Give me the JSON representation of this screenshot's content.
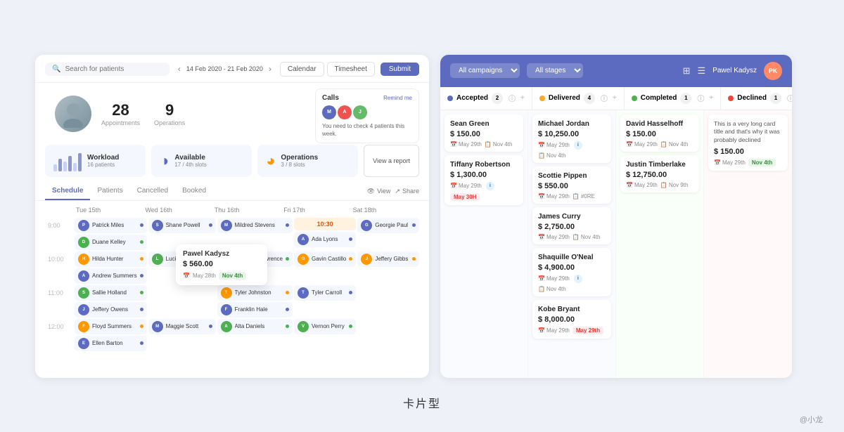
{
  "page": {
    "background": "#eef1f7",
    "bottom_label": "卡片型",
    "watermark": "@小龙"
  },
  "left_panel": {
    "search_placeholder": "Search for patients",
    "date_range": "14 Feb 2020 - 21 Feb 2020",
    "tabs": [
      "Calendar",
      "Timesheet"
    ],
    "submit_label": "Submit",
    "doctor": {
      "appointments": "28",
      "appointments_label": "Appointments",
      "operations": "9",
      "operations_label": "Operations"
    },
    "calls": {
      "title": "Calls",
      "remind_label": "Remind me",
      "text": "You need to check 4 patients this week."
    },
    "metrics": {
      "workload": {
        "title": "Workload",
        "sub": "16 patients"
      },
      "available": {
        "title": "Available",
        "sub": "17 / 4th slots"
      },
      "operations": {
        "title": "Operations",
        "sub": "3 / 8 slots"
      },
      "view_report": "View a report"
    },
    "schedule_tabs": [
      "Schedule",
      "Patients",
      "Cancelled",
      "Booked"
    ],
    "view_label": "View",
    "share_label": "Share",
    "days": [
      "Tue 15th",
      "Wed 16th",
      "Thu 16th",
      "Fri 17th",
      "Sat 18th"
    ],
    "times": [
      "9:00",
      "10:00",
      "11:00",
      "12:00"
    ],
    "appointments": {
      "tue": [
        {
          "name": "Patrick Miles",
          "color": "blue"
        },
        {
          "name": "Duane Kelley",
          "color": "green"
        },
        {
          "name": "Hilda Hunter",
          "color": "orange"
        },
        {
          "name": "Andrew Summers",
          "color": "blue"
        },
        {
          "name": "Sallie Holland",
          "color": "green"
        },
        {
          "name": "Jeffery Owens",
          "color": "blue"
        },
        {
          "name": "Floyd Summers",
          "color": "orange"
        },
        {
          "name": "Ellen Barton",
          "color": "blue"
        }
      ],
      "wed": [
        {
          "name": "Shane Powell",
          "color": "blue"
        },
        {
          "name": "",
          "color": ""
        },
        {
          "name": "",
          "color": ""
        },
        {
          "name": "Lucinda Stanley",
          "color": "green"
        },
        {
          "name": "",
          "color": ""
        },
        {
          "name": "",
          "color": ""
        },
        {
          "name": "Maggie Scott",
          "color": "blue"
        },
        {
          "name": "",
          "color": ""
        }
      ],
      "thu": [
        {
          "name": "Mildred Stevens",
          "color": "blue"
        },
        {
          "name": "",
          "color": ""
        },
        {
          "name": "",
          "color": ""
        },
        {
          "name": "Christian Lawrence",
          "color": "green"
        },
        {
          "name": "Tyler Johnston",
          "color": "orange"
        },
        {
          "name": "Franklin Hale",
          "color": "blue"
        },
        {
          "name": "Alta Daniels",
          "color": "green"
        },
        {
          "name": "",
          "color": ""
        }
      ],
      "fri": [
        {
          "name": "10:30",
          "isTime": true
        },
        {
          "name": "Ada Lyons",
          "color": "blue"
        },
        {
          "name": "Gavin Castillo",
          "color": "orange"
        },
        {
          "name": "",
          "color": ""
        },
        {
          "name": "Tyler Carroll",
          "color": "blue"
        },
        {
          "name": "",
          "color": ""
        },
        {
          "name": "Vernon Perry",
          "color": "green"
        },
        {
          "name": "",
          "color": ""
        }
      ],
      "sat": [
        {
          "name": "Georgie Paul",
          "color": "blue"
        },
        {
          "name": "",
          "color": ""
        },
        {
          "name": "",
          "color": ""
        },
        {
          "name": "Jeffery Gibbs",
          "color": "orange"
        },
        {
          "name": "",
          "color": ""
        },
        {
          "name": "",
          "color": ""
        },
        {
          "name": "",
          "color": ""
        },
        {
          "name": "",
          "color": ""
        }
      ]
    }
  },
  "right_panel": {
    "filter1": "All campaigns",
    "filter2": "All stages",
    "user": "Pawel Kadysz",
    "columns": [
      {
        "name": "Accepted",
        "dot": "blue",
        "count": "2",
        "cards": [
          {
            "name": "Sean Green",
            "amount": "$ 150.00",
            "date1": "May 29th",
            "date2": "Nov 4th"
          },
          {
            "name": "Tiffany Robertson",
            "amount": "$ 1,300.00",
            "date1": "May 29th",
            "date2": "May 30th",
            "tag": "May 30H",
            "tag_type": "red",
            "has_info": true
          }
        ]
      },
      {
        "name": "Delivered",
        "dot": "yellow",
        "count": "4",
        "cards": [
          {
            "name": "Michael Jordan",
            "amount": "$ 10,250.00",
            "date1": "May 29th",
            "date2": "Nov 4th",
            "has_info": true
          },
          {
            "name": "Scottie Pippen",
            "amount": "$ 550.00",
            "date1": "May 29th",
            "date2": "#0RE"
          },
          {
            "name": "James Curry",
            "amount": "$ 2,750.00",
            "date1": "May 29th",
            "date2": "Nov 4th"
          },
          {
            "name": "Shaquille O'Neal",
            "amount": "$ 4,900.00",
            "date1": "May 29th",
            "date2": "Nov 4th",
            "has_info": true
          },
          {
            "name": "Kobe Bryant",
            "amount": "$ 8,000.00",
            "date1": "May 29th",
            "date2": "May 29th",
            "tag": "May 29th",
            "tag_type": "red"
          }
        ]
      },
      {
        "name": "Completed",
        "dot": "green",
        "count": "1",
        "cards": [
          {
            "name": "David Hasselhoff",
            "amount": "$ 150.00",
            "date1": "May 29th",
            "date2": "Nov 4th"
          },
          {
            "name": "Justin Timberlake",
            "amount": "$ 12,750.00",
            "date1": "May 29th",
            "date2": "Nov 9th"
          }
        ]
      },
      {
        "name": "Declined",
        "dot": "red",
        "count": "1",
        "cards": [
          {
            "name": "This is a very long card title and that's why it was probably declined",
            "amount": "$ 150.00",
            "date1": "May 29th",
            "date2": "Nov 4th",
            "tag": "Nov 4th",
            "tag_type": "green",
            "is_long": true
          }
        ]
      }
    ],
    "popup": {
      "name": "Pawel Kadysz",
      "amount": "$ 560.00",
      "date1": "May 28th",
      "date2": "Nov 4th",
      "tag": "Nov 4th",
      "tag_type": "green"
    }
  }
}
